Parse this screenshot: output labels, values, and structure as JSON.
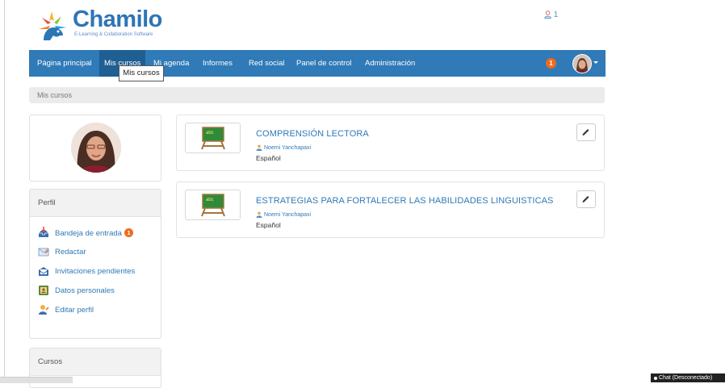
{
  "header": {
    "logo_text": "Chamilo",
    "logo_tagline": "E-Learning & Collaboration Software",
    "online_count": "1"
  },
  "nav": {
    "items": [
      {
        "label": "Página principal"
      },
      {
        "label": "Mis cursos"
      },
      {
        "label": "Mi agenda"
      },
      {
        "label": "Informes"
      },
      {
        "label": "Red social"
      },
      {
        "label": "Panel de control"
      },
      {
        "label": "Administración"
      }
    ],
    "notifications_count": "1",
    "tooltip": "Mis cursos"
  },
  "breadcrumb": "Mis cursos",
  "sidebar": {
    "profile_title": "Perfil",
    "menu": [
      {
        "label": "Bandeja de entrada",
        "badge": "1",
        "icon": "inbox-icon"
      },
      {
        "label": "Redactar",
        "icon": "compose-icon"
      },
      {
        "label": "Invitaciones pendientes",
        "icon": "invitations-icon"
      },
      {
        "label": "Datos personales",
        "icon": "personal-data-icon"
      },
      {
        "label": "Editar perfil",
        "icon": "edit-profile-icon"
      }
    ],
    "courses_title": "Cursos"
  },
  "courses": [
    {
      "title": "COMPRENSIÓN LECTORA",
      "teacher": "Noemi Yanchapaxi",
      "language": "Español"
    },
    {
      "title": "ESTRATEGIAS PARA FORTALECER LAS HABILIDADES LINGUISTICAS",
      "teacher": "Noemi Yanchapaxi",
      "language": "Español"
    }
  ],
  "chat": {
    "label": "Chat (Desconectado)"
  },
  "colors": {
    "brand": "#2f7ab7",
    "badge": "#f06a1d",
    "nav_active": "#1f5f93"
  }
}
